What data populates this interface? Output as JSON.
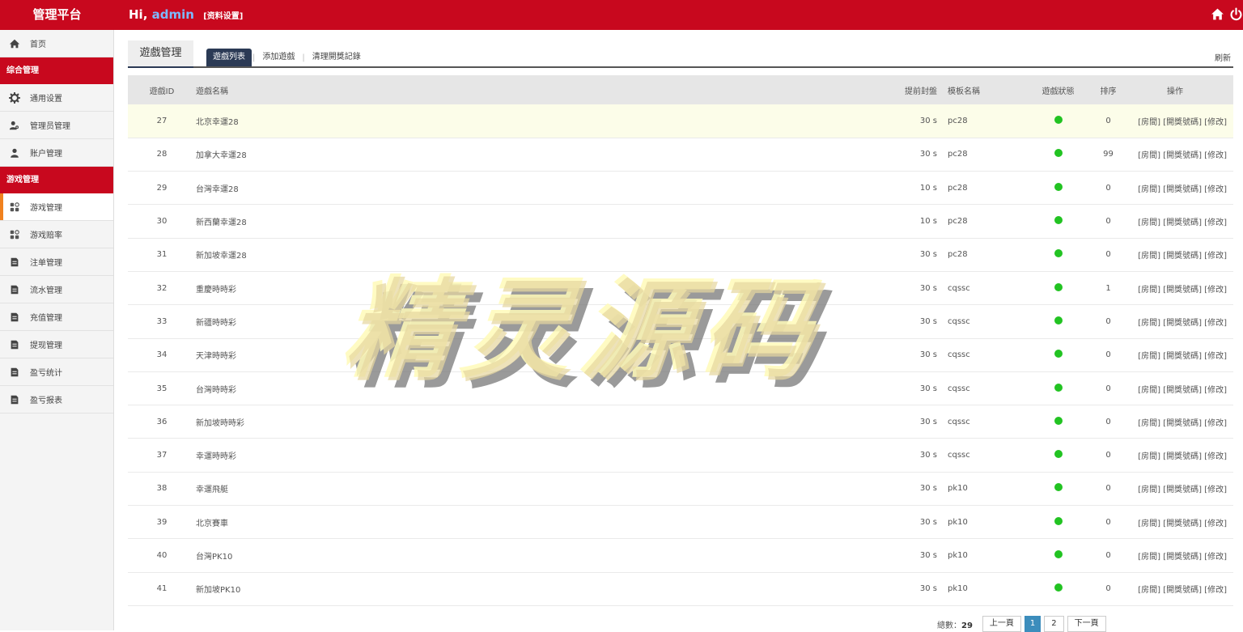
{
  "header": {
    "brand": "管理平台",
    "greeting": "Hi,",
    "username": "admin",
    "profile_link": "[资料设置]"
  },
  "icons": {
    "home": "home-icon",
    "power": "power-icon"
  },
  "sidebar": {
    "home": "首页",
    "section1": "综合管理",
    "items1": [
      "通用设置",
      "管理员管理",
      "账户管理"
    ],
    "section2": "游戏管理",
    "items2": [
      "游戏管理",
      "游戏赔率",
      "注单管理",
      "流水管理",
      "充值管理",
      "提现管理",
      "盈亏统计",
      "盈亏报表"
    ]
  },
  "main": {
    "tab": "遊戲管理",
    "subtabs": [
      "遊戲列表",
      "添加遊戲",
      "清理開獎記錄"
    ],
    "refresh": "刷新"
  },
  "table": {
    "headers": [
      "遊戲ID",
      "遊戲名稱",
      "提前封盤",
      "模板名稱",
      "遊戲狀態",
      "排序",
      "操作"
    ],
    "op_room": "[房間]",
    "op_draw": "[開獎號碼]",
    "op_edit": "[修改]",
    "rows": [
      {
        "id": "27",
        "name": "北京幸運28",
        "close": "30 s",
        "tpl": "pc28",
        "status": "on",
        "sort": "0"
      },
      {
        "id": "28",
        "name": "加拿大幸運28",
        "close": "30 s",
        "tpl": "pc28",
        "status": "on",
        "sort": "99"
      },
      {
        "id": "29",
        "name": "台灣幸運28",
        "close": "10 s",
        "tpl": "pc28",
        "status": "on",
        "sort": "0"
      },
      {
        "id": "30",
        "name": "新西蘭幸運28",
        "close": "10 s",
        "tpl": "pc28",
        "status": "on",
        "sort": "0"
      },
      {
        "id": "31",
        "name": "新加坡幸運28",
        "close": "30 s",
        "tpl": "pc28",
        "status": "on",
        "sort": "0"
      },
      {
        "id": "32",
        "name": "重慶時時彩",
        "close": "30 s",
        "tpl": "cqssc",
        "status": "on",
        "sort": "1"
      },
      {
        "id": "33",
        "name": "新疆時時彩",
        "close": "30 s",
        "tpl": "cqssc",
        "status": "on",
        "sort": "0"
      },
      {
        "id": "34",
        "name": "天津時時彩",
        "close": "30 s",
        "tpl": "cqssc",
        "status": "on",
        "sort": "0"
      },
      {
        "id": "35",
        "name": "台灣時時彩",
        "close": "30 s",
        "tpl": "cqssc",
        "status": "on",
        "sort": "0"
      },
      {
        "id": "36",
        "name": "新加坡時時彩",
        "close": "30 s",
        "tpl": "cqssc",
        "status": "on",
        "sort": "0"
      },
      {
        "id": "37",
        "name": "幸運時時彩",
        "close": "30 s",
        "tpl": "cqssc",
        "status": "on",
        "sort": "0"
      },
      {
        "id": "38",
        "name": "幸運飛艇",
        "close": "30 s",
        "tpl": "pk10",
        "status": "on",
        "sort": "0"
      },
      {
        "id": "39",
        "name": "北京賽車",
        "close": "30 s",
        "tpl": "pk10",
        "status": "on",
        "sort": "0"
      },
      {
        "id": "40",
        "name": "台灣PK10",
        "close": "30 s",
        "tpl": "pk10",
        "status": "on",
        "sort": "0"
      },
      {
        "id": "41",
        "name": "新加坡PK10",
        "close": "30 s",
        "tpl": "pk10",
        "status": "on",
        "sort": "0"
      }
    ]
  },
  "pager": {
    "total_label": "總數：",
    "total": "29",
    "prev": "上一頁",
    "pages": [
      "1",
      "2"
    ],
    "current": "1",
    "next": "下一頁"
  },
  "watermark": "精灵源码",
  "colors": {
    "brand_red": "#c8081e",
    "nav_dark": "#2b3a55",
    "status_on": "#22c322",
    "active_marker": "#f0811e",
    "page_current": "#3c8dbc"
  }
}
